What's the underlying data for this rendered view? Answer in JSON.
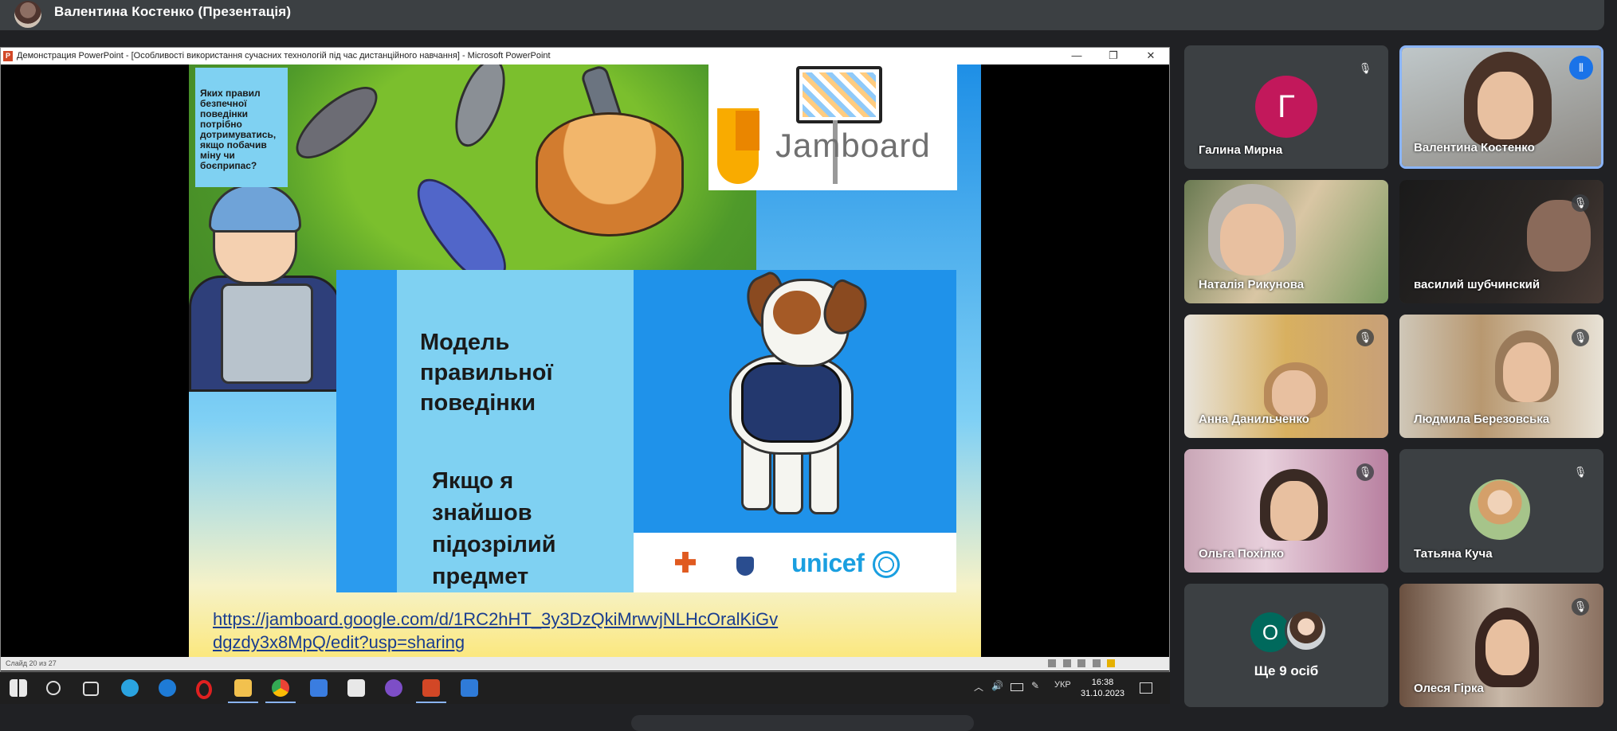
{
  "meeting": {
    "presenter_label": "Валентина Костенко (Презентація)"
  },
  "powerpoint": {
    "window_title": "Демонстрация PowerPoint - [Особливості використання сучасних технологій під час дистанційного навчання] - Microsoft PowerPoint",
    "app_icon_letter": "P",
    "window_buttons": {
      "minimize": "—",
      "maximize": "❐",
      "close": "✕"
    },
    "slide_counter": "Слайд 20 из 27"
  },
  "slide": {
    "question": "Яких правил безпечної поведінки потрібно дотримуватись, якщо побачив міну чи боєприпас?",
    "jamboard_label": "Jamboard",
    "model_title": "Модель\nправильної\nповедінки",
    "found_title": "Якщо я\nзнайшов\nпідозрілий\nпредмет",
    "unicef_label": "unicef",
    "link": "https://jamboard.google.com/d/1RC2hHT_3y3DzQkiMrwvjNLHcOralKiGvdgzdy3x8MpQ/edit?usp=sharing"
  },
  "taskbar": {
    "language": "УКР",
    "time": "16:38",
    "date": "31.10.2023",
    "apps": [
      "start-icon",
      "search-icon",
      "task-view-icon",
      "telegram-icon",
      "edge-icon",
      "opera-icon",
      "file-explorer-icon",
      "chrome-icon",
      "mail-icon",
      "store-icon",
      "viber-icon",
      "powerpoint-icon",
      "app-icon"
    ]
  },
  "participants": [
    {
      "name": "Галина Мирна",
      "initial": "Г",
      "muted": true,
      "avatar_color": "#c2185b"
    },
    {
      "name": "Валентина Костенко",
      "muted": false,
      "speaking": true
    },
    {
      "name": "Наталія Рикунова",
      "muted": false
    },
    {
      "name": "василий шубчинский",
      "muted": true
    },
    {
      "name": "Анна Данильченко",
      "muted": true
    },
    {
      "name": "Людмила Березовська",
      "muted": true
    },
    {
      "name": "Ольга Похілко",
      "muted": true
    },
    {
      "name": "Татьяна Куча",
      "muted": true
    },
    {
      "more_label": "Ще 9 осіб",
      "initial": "О"
    },
    {
      "name": "Олеся Гірка",
      "muted": true
    }
  ],
  "icons": {
    "mic_off": "🎤",
    "speaking": "⦀"
  },
  "colors": {
    "meet_bg": "#202124",
    "tile_bg": "#3c4043",
    "active_border": "#8ab4f8",
    "speaking_badge": "#1a73e8"
  }
}
